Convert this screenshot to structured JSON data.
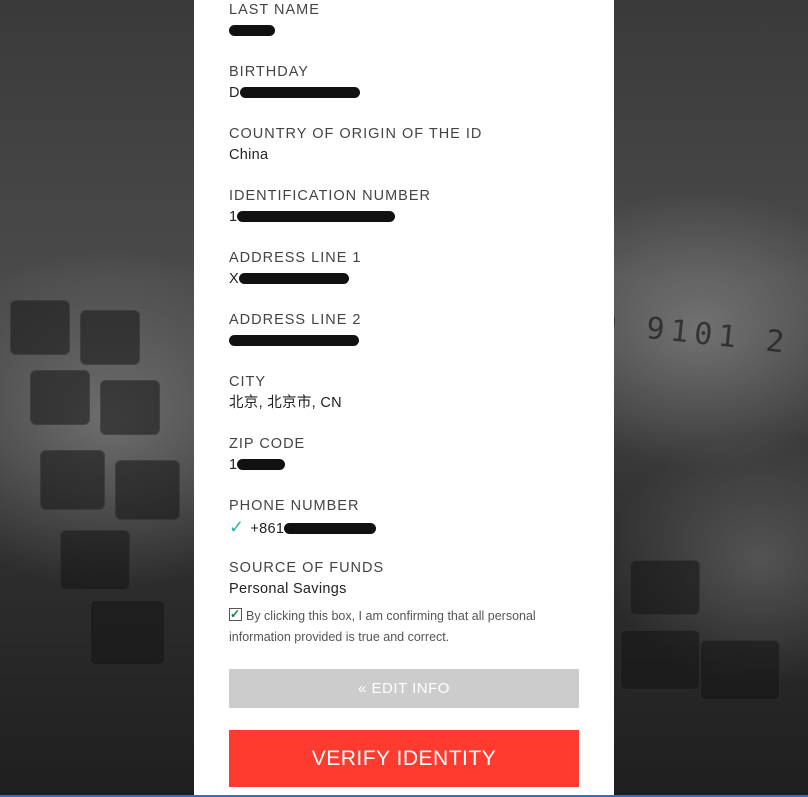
{
  "fields": [
    {
      "label": "LAST NAME",
      "value": ""
    },
    {
      "label": "BIRTHDAY",
      "value": "D"
    },
    {
      "label": "COUNTRY OF ORIGIN OF THE ID",
      "value": "China"
    },
    {
      "label": "IDENTIFICATION NUMBER",
      "value": "1"
    },
    {
      "label": "ADDRESS LINE 1",
      "value": "X"
    },
    {
      "label": "ADDRESS LINE 2",
      "value": ""
    },
    {
      "label": "CITY",
      "value": "北京, 北京市, CN"
    },
    {
      "label": "ZIP CODE",
      "value": "1"
    },
    {
      "label": "PHONE NUMBER",
      "value": "+861",
      "icon": "checkmark-icon"
    },
    {
      "label": "SOURCE OF FUNDS",
      "value": "Personal Savings"
    }
  ],
  "consent": {
    "checked": true,
    "text": "By clicking this box, I am confirming that all personal information provided is true and correct."
  },
  "buttons": {
    "edit_label": "« EDIT INFO",
    "verify_label": "VERIFY IDENTITY"
  },
  "background": {
    "card_number_fragment": "0 9101 2"
  },
  "colors": {
    "verify_button": "#ff3b30",
    "edit_button": "#cccccc",
    "checkmark": "#2bb4a6"
  }
}
